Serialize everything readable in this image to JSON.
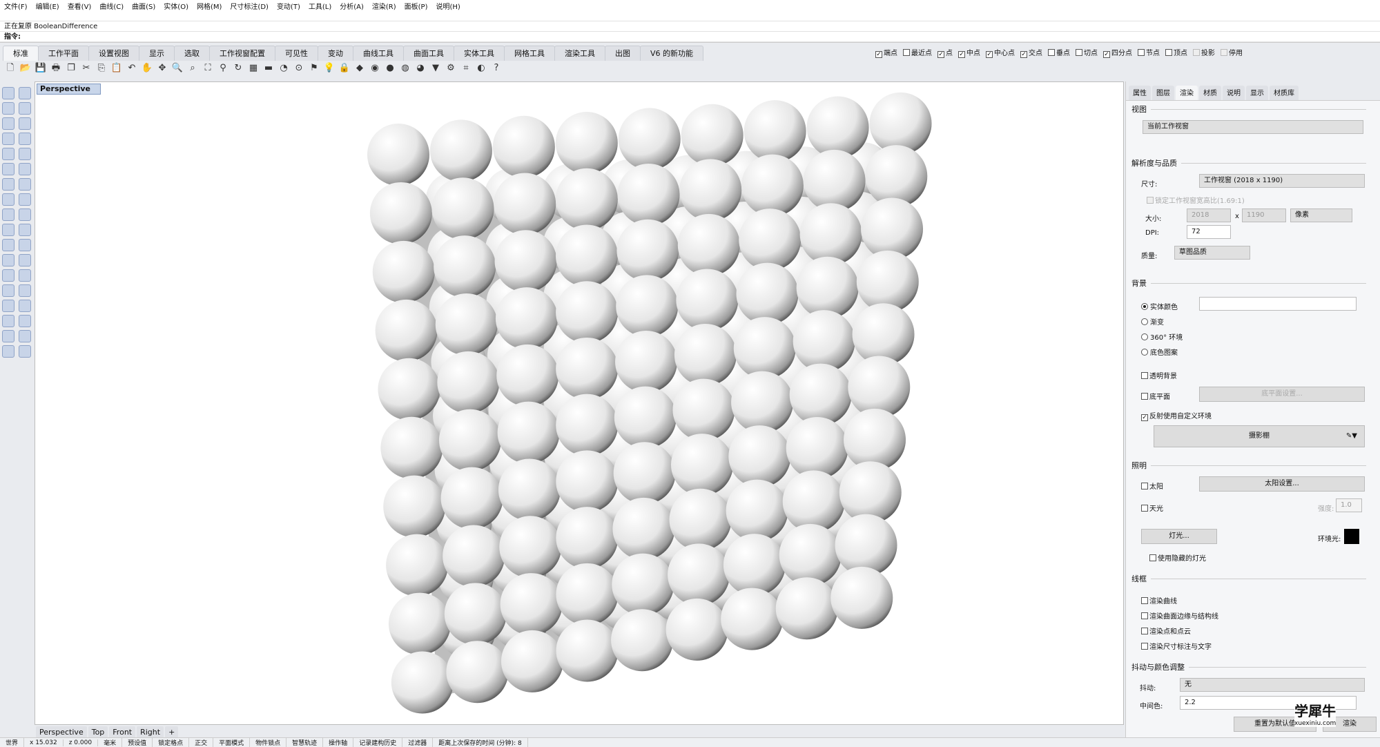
{
  "menu": [
    "文件(F)",
    "编辑(E)",
    "查看(V)",
    "曲线(C)",
    "曲面(S)",
    "实体(O)",
    "网格(M)",
    "尺寸标注(D)",
    "变动(T)",
    "工具(L)",
    "分析(A)",
    "渲染(R)",
    "面板(P)",
    "说明(H)"
  ],
  "command": {
    "history": "正在复原 BooleanDifference",
    "prompt": "指令:"
  },
  "tabs": [
    "标准",
    "工作平面",
    "设置视图",
    "显示",
    "选取",
    "工作视窗配置",
    "可见性",
    "变动",
    "曲线工具",
    "曲面工具",
    "实体工具",
    "网格工具",
    "渲染工具",
    "出图",
    "V6 的新功能"
  ],
  "osnap": [
    {
      "label": "端点",
      "checked": true
    },
    {
      "label": "最近点",
      "checked": false
    },
    {
      "label": "点",
      "checked": true
    },
    {
      "label": "中点",
      "checked": true
    },
    {
      "label": "中心点",
      "checked": true
    },
    {
      "label": "交点",
      "checked": true
    },
    {
      "label": "垂点",
      "checked": false
    },
    {
      "label": "切点",
      "checked": false
    },
    {
      "label": "四分点",
      "checked": true
    },
    {
      "label": "节点",
      "checked": false
    },
    {
      "label": "顶点",
      "checked": false
    },
    {
      "label": "投影",
      "checked": false,
      "disabled": true
    },
    {
      "label": "停用",
      "checked": false,
      "disabled": true
    }
  ],
  "viewport": {
    "label": "Perspective",
    "tabs": [
      "Perspective",
      "Top",
      "Front",
      "Right",
      "+"
    ]
  },
  "status": [
    "世界",
    "x 15.032",
    "z 0.000",
    "毫米",
    "预设值",
    "锁定格点",
    "正交",
    "平面模式",
    "物件锁点",
    "智慧轨迹",
    "操作轴",
    "记录建构历史",
    "过滤器",
    "距离上次保存的时间 (分钟): 8"
  ],
  "panel": {
    "tabs": [
      "属性",
      "图层",
      "渲染",
      "材质",
      "说明",
      "显示",
      "材质库"
    ],
    "view": {
      "title": "视图",
      "value": "当前工作视窗"
    },
    "res": {
      "title": "解析度与品质",
      "size_label": "尺寸:",
      "size_value": "工作视窗 (2018 x 1190)",
      "lock": "锁定工作视窗宽高比(1.69:1)",
      "dim_label": "大小:",
      "w": "2018",
      "x": "x",
      "h": "1190",
      "unit": "像素",
      "dpi_label": "DPI:",
      "dpi": "72",
      "quality_label": "质量:",
      "quality": "草图品质"
    },
    "bg": {
      "title": "背景",
      "opts": [
        "实体颜色",
        "渐变",
        "360° 环境",
        "底色图案"
      ],
      "transparent": "透明背景",
      "ground": "底平面",
      "ground_btn": "底平面设置...",
      "reflect": "反射使用自定义环境",
      "env": "摄影棚"
    },
    "light": {
      "title": "照明",
      "sun": "太阳",
      "sun_btn": "太阳设置...",
      "sky": "天光",
      "strength_label": "强度:",
      "strength": "1.0",
      "lights_btn": "灯光...",
      "ambient_label": "环境光:",
      "hidden": "使用隐藏的灯光"
    },
    "wire": {
      "title": "线框",
      "items": [
        "渲染曲线",
        "渲染曲面边缘与结构线",
        "渲染点和点云",
        "渲染尺寸标注与文字"
      ]
    },
    "dither": {
      "title": "抖动与颜色调整",
      "label": "抖动:",
      "value": "无",
      "gamma_label": "中间色:",
      "gamma": "2.2"
    },
    "reset": "重置为默认值",
    "render": "渲染"
  },
  "watermark": {
    "text": "学犀牛",
    "url": "xuexiniu.com"
  }
}
